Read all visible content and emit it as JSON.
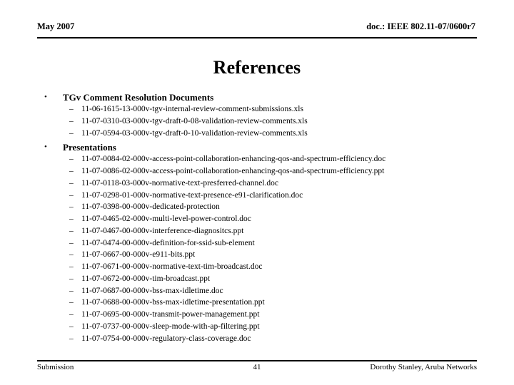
{
  "header": {
    "date": "May 2007",
    "doc": "doc.: IEEE 802.11-07/0600r7"
  },
  "title": "References",
  "bullet_glyph": "•",
  "dash_glyph": "–",
  "sections": [
    {
      "heading": "TGv Comment Resolution Documents",
      "items": [
        "11-06-1615-13-000v-tgv-internal-review-comment-submissions.xls",
        "11-07-0310-03-000v-tgv-draft-0-08-validation-review-comments.xls",
        "11-07-0594-03-000v-tgv-draft-0-10-validation-review-comments.xls"
      ]
    },
    {
      "heading": "Presentations",
      "items": [
        "11-07-0084-02-000v-access-point-collaboration-enhancing-qos-and-spectrum-efficiency.doc",
        "11-07-0086-02-000v-access-point-collaboration-enhancing-qos-and-spectrum-efficiency.ppt",
        "11-07-0118-03-000v-normative-text-presferred-channel.doc",
        "11-07-0298-01-000v-normative-text-presence-e91-clarification.doc",
        "11-07-0398-00-000v-dedicated-protection",
        "11-07-0465-02-000v-multi-level-power-control.doc",
        "11-07-0467-00-000v-interference-diagnositcs.ppt",
        "11-07-0474-00-000v-definition-for-ssid-sub-element",
        "11-07-0667-00-000v-e911-bits.ppt",
        "11-07-0671-00-000v-normative-text-tim-broadcast.doc",
        "11-07-0672-00-000v-tim-broadcast.ppt",
        "11-07-0687-00-000v-bss-max-idletime.doc",
        "11-07-0688-00-000v-bss-max-idletime-presentation.ppt",
        "11-07-0695-00-000v-transmit-power-management.ppt",
        "11-07-0737-00-000v-sleep-mode-with-ap-filtering.ppt",
        "11-07-0754-00-000v-regulatory-class-coverage.doc"
      ]
    }
  ],
  "footer": {
    "left": "Submission",
    "page": "41",
    "right": "Dorothy Stanley, Aruba Networks"
  }
}
